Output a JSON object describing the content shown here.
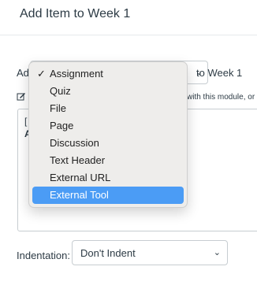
{
  "dialog": {
    "title": "Add Item to Week 1"
  },
  "add_row": {
    "prefix": "Add",
    "selected_value": "Assignment",
    "to_label": "to Week 1"
  },
  "description": {
    "partial_text": "with this module, or a"
  },
  "listbox": {
    "line1": "[",
    "line2": "A"
  },
  "dropdown": {
    "items": [
      {
        "label": "Assignment",
        "checked": true
      },
      {
        "label": "Quiz"
      },
      {
        "label": "File"
      },
      {
        "label": "Page"
      },
      {
        "label": "Discussion"
      },
      {
        "label": "Text Header"
      },
      {
        "label": "External URL"
      },
      {
        "label": "External Tool",
        "highlighted": true
      }
    ]
  },
  "indentation": {
    "label": "Indentation:",
    "value": "Don't Indent"
  },
  "icons": {
    "checkmark": "checkmark-icon",
    "chevron": "chevron-down-icon",
    "edit": "edit-icon"
  },
  "colors": {
    "highlight": "#4b9cf5",
    "border": "#c7cdd1",
    "text": "#2d3b45"
  }
}
